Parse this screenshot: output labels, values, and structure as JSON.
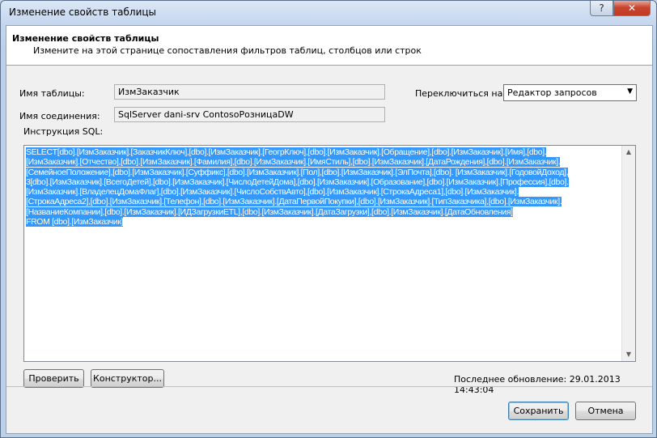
{
  "window": {
    "title": "Изменение свойств таблицы",
    "help": "?",
    "close": "✕"
  },
  "header": {
    "title": "Изменение свойств таблицы",
    "subtitle": "Измените на этой странице сопоставления фильтров таблиц, столбцов или строк"
  },
  "form": {
    "table_name_label": "Имя таблицы:",
    "table_name_value": "ИзмЗаказчик",
    "connection_label": "Имя соединения:",
    "connection_value": "SqlServer dani-srv ContosoРозницаDW",
    "switch_label": "Переключиться на:",
    "switch_value": "Редактор запросов",
    "sql_label": "Инструкция SQL:"
  },
  "sql_lines": [
    "SELECT[dbo].[ИзмЗаказчик].[ЗаказчикКлюч],[dbo].[ИзмЗаказчик].[ГеогрКлюч],[dbo].[ИзмЗаказчик].[Обращение],[dbo].[ИзмЗаказчик].[Имя],[dbo].",
    "[ИзмЗаказчик].[Отчество],[dbo].[ИзмЗаказчик].[Фамилия],[dbo].[ИзмЗаказчик].[ИмяСтиль],[dbo].[ИзмЗаказчик].[ДатаРождения],[dbo].[ИзмЗаказчик].",
    "[СемейноеПоложение],[dbo].[ИзмЗаказчик].[Суффикс],[dbo].[ИзмЗаказчик].[Пол],[dbo].[ИзмЗаказчик].[ЭлПочта],[dbo]. [ИзмЗаказчик].[ГодовойДоход],",
    "3[dbo].[ИзмЗаказчик].[ВсегоДетей],[dbo].[ИзмЗаказчик].[ЧислоДетейДома],[dbo].[ИзмЗаказчик].[Образование],[dbo].[ИзмЗаказчик].[Профессия],[dbo].",
    "[ИзмЗаказчик].[ВладелецДомаФлаг],[dbo].[ИзмЗаказчик].[ЧислоСобствАвто],[dbo].[ИзмЗаказчик].[СтрокаАдреса1],[dbo].[ИзмЗаказчик].",
    " [СтрокаАдреса2],[dbo].[ИзмЗаказчик].[Телефон],[dbo].[ИзмЗаказчик].[ДатаПервойПокупки],[dbo].[ИзмЗаказчик].[ТипЗаказчика],[dbo].[ИзмЗаказчик].",
    "[НазваниеКомпании],[dbo].[ИзмЗаказчик].[ИДЗагрузкиETL],[dbo].[ИзмЗаказчик].[ДатаЗагрузки],[dbo].[ИзмЗаказчик].[ДатаОбновления]",
    "FROM [dbo].[ИзмЗаказчик]"
  ],
  "buttons": {
    "validate": "Проверить",
    "designer": "Конструктор...",
    "save": "Сохранить",
    "cancel": "Отмена"
  },
  "status": {
    "last_updated": "Последнее обновление: 29.01.2013 14:43:04"
  },
  "colors": {
    "selection": "#3399ff",
    "title_gradient": "#c4d6ee",
    "close_button": "#c9452f"
  }
}
